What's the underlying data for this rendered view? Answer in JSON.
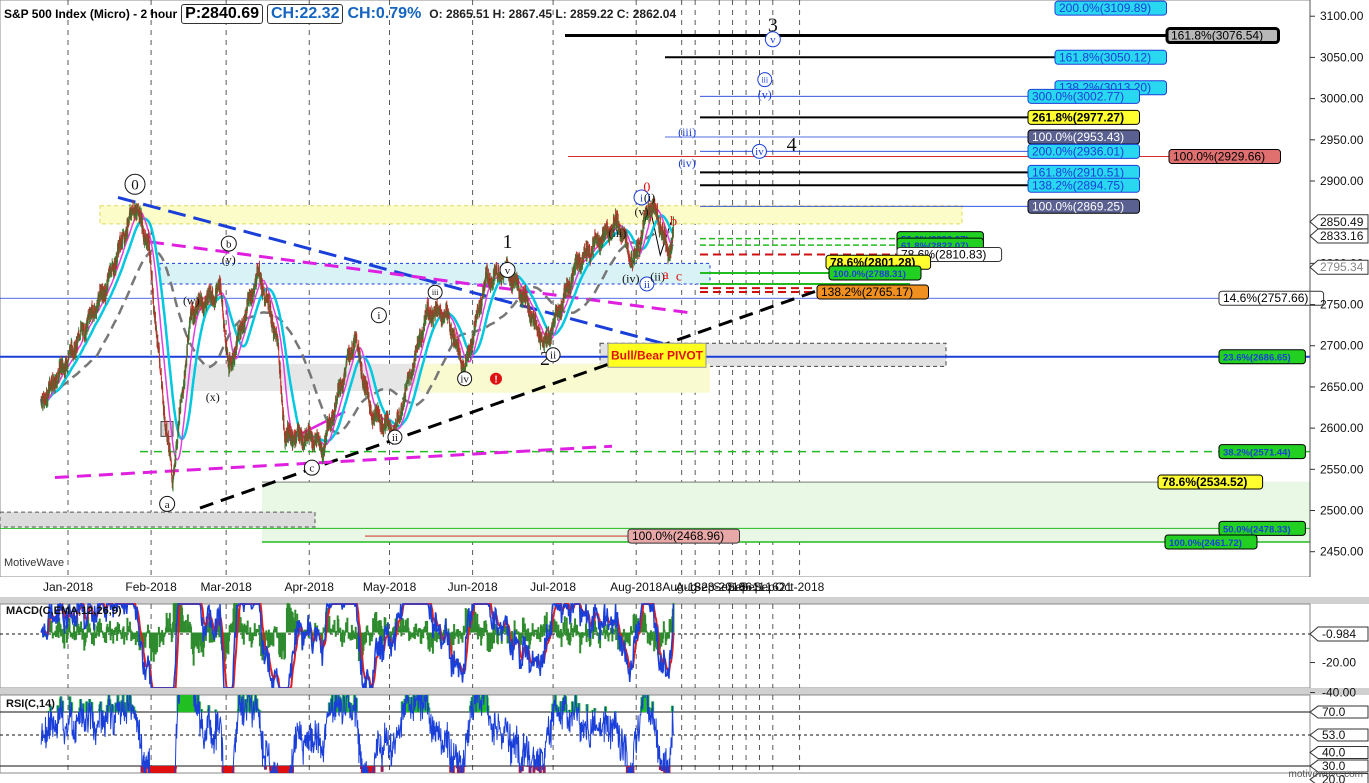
{
  "header": {
    "title": "S&P 500 Index (Micro) - 2 hour",
    "price": "P:2840.69",
    "change": "CH:22.32",
    "change_pct": "CH:0.79%",
    "ohlc": "O: 2865.51  H: 2867.45  L: 2859.22  C: 2862.04"
  },
  "brand": "MotiveWave",
  "site": "motivewave.com",
  "colors": {
    "price_up": "#2e7d32",
    "price_down": "#c62828",
    "ma_fast": "#00c8e0",
    "ma_mid": "#e040e0",
    "ma_slow": "#777777",
    "macd_line": "#1a3fd9",
    "signal_line": "#e02020",
    "rsi_line": "#1a3fd9"
  },
  "chart_data": {
    "type": "line",
    "title": "S&P 500 Index (Micro) - 2 hour",
    "x_axis_labels": [
      "Jan-2018",
      "Feb-2018",
      "Mar-2018",
      "Apr-2018",
      "May-2018",
      "Jun-2018",
      "Jul-2018",
      "Aug-2018",
      "Aug-18",
      "Aug-23",
      "Sep-2018",
      "Sep-06",
      "Sep-11",
      "Sep-16",
      "Sep-21",
      "Oct-2018"
    ],
    "y_axis_labels": [
      "3100.00",
      "3050.00",
      "3000.00",
      "2950.00",
      "2900.00",
      "2850.00",
      "2800.00",
      "2750.00",
      "2700.00",
      "2650.00",
      "2600.00",
      "2550.00",
      "2500.00",
      "2450.00"
    ],
    "ylim": [
      2430,
      3110
    ],
    "price_path": {
      "dates": [
        "2017-12-22",
        "2018-01-02",
        "2018-01-15",
        "2018-01-26",
        "2018-01-31",
        "2018-02-05",
        "2018-02-09",
        "2018-02-16",
        "2018-02-27",
        "2018-03-02",
        "2018-03-13",
        "2018-03-20",
        "2018-03-23",
        "2018-04-02",
        "2018-04-06",
        "2018-04-18",
        "2018-04-24",
        "2018-05-03",
        "2018-05-15",
        "2018-05-22",
        "2018-05-29",
        "2018-06-06",
        "2018-06-14",
        "2018-06-20",
        "2018-06-25",
        "2018-06-28",
        "2018-07-10",
        "2018-07-25",
        "2018-07-31",
        "2018-08-06",
        "2018-08-09",
        "2018-08-13",
        "2018-08-15"
      ],
      "values": [
        2630,
        2690,
        2770,
        2872,
        2823,
        2650,
        2535,
        2740,
        2770,
        2670,
        2790,
        2710,
        2590,
        2590,
        2575,
        2710,
        2620,
        2595,
        2740,
        2740,
        2670,
        2780,
        2790,
        2760,
        2720,
        2700,
        2800,
        2850,
        2800,
        2870,
        2860,
        2810,
        2840
      ]
    },
    "series": [
      {
        "name": "MACD(C,EMA,12,26,9)",
        "last_value": -0.984,
        "y_ticks": [
          -0.984,
          -20.0,
          -40.0
        ]
      },
      {
        "name": "RSI(C,14)",
        "last_value": 53.0,
        "y_ticks": [
          70.0,
          53.0,
          40.0,
          30.0,
          20.0
        ]
      }
    ],
    "fib_labels": [
      {
        "text": "200.0%(3109.89)",
        "price": 3109.89,
        "style": "cyan"
      },
      {
        "text": "161.8%(3076.54)",
        "price": 3076.54,
        "style": "black"
      },
      {
        "text": "161.8%(3050.12)",
        "price": 3050.12,
        "style": "cyan"
      },
      {
        "text": "138.2%(3013.20)",
        "price": 3013.2,
        "style": "cyan"
      },
      {
        "text": "300.0%(3002.77)",
        "price": 3002.77,
        "style": "cyan"
      },
      {
        "text": "261.8%(2977.27)",
        "price": 2977.27,
        "style": "yellow"
      },
      {
        "text": "100.0%(2953.43)",
        "price": 2953.43,
        "style": "slate"
      },
      {
        "text": "200.0%(2936.01)",
        "price": 2936.01,
        "style": "cyan"
      },
      {
        "text": "100.0%(2929.66)",
        "price": 2929.66,
        "style": "red"
      },
      {
        "text": "161.8%(2910.51)",
        "price": 2910.51,
        "style": "cyan"
      },
      {
        "text": "138.2%(2894.75)",
        "price": 2894.75,
        "style": "cyan"
      },
      {
        "text": "100.0%(2869.25)",
        "price": 2869.25,
        "style": "slate"
      },
      {
        "text": "50.0%(2830.07)",
        "price": 2830.07,
        "style": "green"
      },
      {
        "text": "61.8%(2822.07)",
        "price": 2822.07,
        "style": "green"
      },
      {
        "text": "78.6%(2810.83)",
        "price": 2810.83,
        "style": "white"
      },
      {
        "text": "78.6%(2801.28)",
        "price": 2801.28,
        "style": "yellow"
      },
      {
        "text": "100.0%(2788.31)",
        "price": 2788.31,
        "style": "green"
      },
      {
        "text": "138.2%(2765.17)",
        "price": 2765.17,
        "style": "orange"
      },
      {
        "text": "14.6%(2757.66)",
        "price": 2757.66,
        "style": "white"
      },
      {
        "text": "23.6%(2686.65)",
        "price": 2686.65,
        "style": "green"
      },
      {
        "text": "38.2%(2571.44)",
        "price": 2571.44,
        "style": "green"
      },
      {
        "text": "78.6%(2534.52)",
        "price": 2534.52,
        "style": "yellow"
      },
      {
        "text": "50.0%(2478.33)",
        "price": 2478.33,
        "style": "green"
      },
      {
        "text": "100.0%(2468.96)",
        "price": 2468.96,
        "style": "rosy"
      },
      {
        "text": "100.0%(2461.72)",
        "price": 2461.72,
        "style": "green"
      }
    ],
    "axis_price_tags": [
      {
        "text": "2850.49",
        "price": 2850.49
      },
      {
        "text": "2833.16",
        "price": 2833.16
      },
      {
        "text": "2795.34",
        "price": 2795.34
      }
    ],
    "pivot_label": "Bull/Bear PIVOT",
    "wave_labels": [
      {
        "text": "0",
        "date": "2018-01-26",
        "price": 2896,
        "circle": true
      },
      {
        "text": "b",
        "date": "2018-03-02",
        "price": 2824,
        "circle": true
      },
      {
        "text": "(y)",
        "date": "2018-03-02",
        "price": 2805
      },
      {
        "text": "(w)",
        "date": "2018-02-16",
        "price": 2755
      },
      {
        "text": "(x)",
        "date": "2018-02-24",
        "price": 2638
      },
      {
        "text": "a",
        "date": "2018-02-07",
        "price": 2508,
        "circle": true
      },
      {
        "text": "c",
        "date": "2018-04-02",
        "price": 2552,
        "circle": true
      },
      {
        "text": "i",
        "date": "2018-04-27",
        "price": 2737,
        "circle": true
      },
      {
        "text": "ii",
        "date": "2018-05-03",
        "price": 2589,
        "circle": true
      },
      {
        "text": "iii",
        "date": "2018-05-18",
        "price": 2765,
        "circle": true
      },
      {
        "text": "iv",
        "date": "2018-05-29",
        "price": 2660,
        "circle": true
      },
      {
        "text": "v",
        "date": "2018-06-14",
        "price": 2792,
        "circle": true
      },
      {
        "text": "1",
        "date": "2018-06-14",
        "price": 2827,
        "big": true
      },
      {
        "text": "2",
        "date": "2018-06-28",
        "price": 2685,
        "big": true
      },
      {
        "text": "ii",
        "date": "2018-07-01",
        "price": 2689,
        "circle": true
      },
      {
        "text": "(iii)",
        "date": "2018-07-25",
        "price": 2837
      },
      {
        "text": "(iv)",
        "date": "2018-07-30",
        "price": 2782
      },
      {
        "text": "(v)",
        "date": "2018-08-03",
        "price": 2863
      },
      {
        "text": "i",
        "date": "2018-08-03",
        "price": 2880,
        "circle": true
      },
      {
        "text": "ii",
        "date": "2018-08-05",
        "price": 2775,
        "circle": true
      },
      {
        "text": "(i)",
        "date": "2018-08-06",
        "price": 2880
      },
      {
        "text": "(ii)",
        "date": "2018-08-09",
        "price": 2784
      },
      {
        "text": "0",
        "date": "2018-08-05",
        "price": 2893,
        "red": true
      },
      {
        "text": "a",
        "date": "2018-08-12",
        "price": 2787,
        "red": true
      },
      {
        "text": "b",
        "date": "2018-08-15",
        "price": 2852,
        "red": true
      },
      {
        "text": "c",
        "date": "2018-08-17",
        "price": 2785,
        "red": true
      },
      {
        "text": "(iv)",
        "date": "2018-08-20",
        "price": 2922
      },
      {
        "text": "(iii)",
        "date": "2018-08-20",
        "price": 2960
      },
      {
        "text": "iii",
        "date": "2018-09-18",
        "price": 3023,
        "circle": true
      },
      {
        "text": "(v)",
        "date": "2018-09-18",
        "price": 3005
      },
      {
        "text": "iv",
        "date": "2018-09-16",
        "price": 2936,
        "circle": true
      },
      {
        "text": "3",
        "date": "2018-09-21",
        "price": 3090,
        "big": true
      },
      {
        "text": "v",
        "date": "2018-09-21",
        "price": 3072,
        "circle": true
      },
      {
        "text": "4",
        "date": "2018-09-28",
        "price": 2945,
        "big": true
      }
    ]
  }
}
